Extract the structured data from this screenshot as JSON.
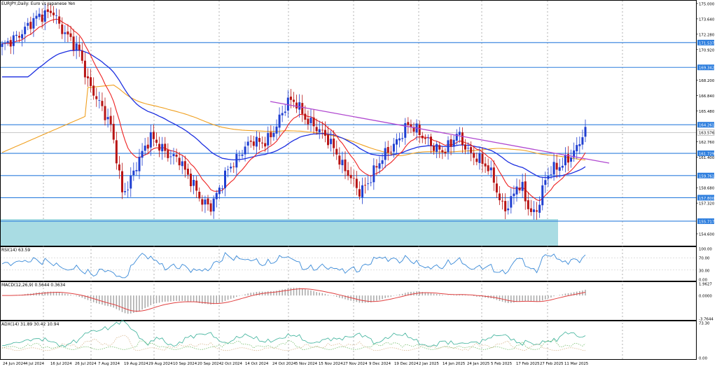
{
  "window": {
    "title": "EURJPY,Daily: Euro vs Japanese Yen"
  },
  "colors": {
    "bull": "#1f3fd1",
    "bear": "#b81414",
    "ma_fast": "#ee2222",
    "ma_mid": "#1c2fe0",
    "ma_slow": "#f0a020",
    "trendline": "#b048d0",
    "hline": "#2f7fde",
    "zone": "#a9dce3",
    "rsi": "#3a8ad8",
    "macd_signal": "#e04040",
    "macd_hist": "#a8a8a8",
    "adx_main": "#38b098",
    "adx_plus": "#7ac070",
    "adx_minus": "#d8b890"
  },
  "price_axis": {
    "ticks": [
      "175.000",
      "173.640",
      "172.280",
      "170.920",
      "169.560",
      "168.200",
      "166.840",
      "165.480",
      "164.120",
      "162.760",
      "161.400",
      "160.040",
      "158.680",
      "157.320",
      "155.960",
      "154.600"
    ]
  },
  "hlines": [
    {
      "label": "171.537",
      "value": 171.537
    },
    {
      "label": "169.342",
      "value": 169.342
    },
    {
      "label": "164.261",
      "value": 164.261
    },
    {
      "label": "163.576",
      "value": 163.576
    },
    {
      "label": "161.729",
      "value": 161.729
    },
    {
      "label": "159.761",
      "value": 159.761
    },
    {
      "label": "157.800",
      "value": 157.8
    },
    {
      "label": "155.717",
      "value": 155.717
    }
  ],
  "date_axis": {
    "labels": [
      "24 Jun 2024",
      "4 Jul 2024",
      "16 Jul 2024",
      "26 Jul 2024",
      "7 Aug 2024",
      "19 Aug 2024",
      "29 Aug 2024",
      "10 Sep 2024",
      "20 Sep 2024",
      "2 Oct 2024",
      "14 Oct 2024",
      "24 Oct 2024",
      "5 Nov 2024",
      "15 Nov 2024",
      "27 Nov 2024",
      "9 Dec 2024",
      "19 Dec 2024",
      "2 Jan 2025",
      "14 Jan 2025",
      "24 Jan 2025",
      "5 Feb 2025",
      "17 Feb 2025",
      "27 Feb 2025",
      "11 Mar 2025"
    ]
  },
  "rsi": {
    "title": "RSI(14) 63.59",
    "ticks": [
      "100.00",
      "70.00",
      "30.00",
      "0.00"
    ]
  },
  "macd": {
    "title": "MACD(12,26,9) 0.5644 0.3634",
    "ticks": [
      "1.9627",
      "0.0000",
      "-3.7644"
    ]
  },
  "adx": {
    "title": "ADX(14) 31.89 30.42 10.94",
    "ticks": [
      "73.30",
      "0.00"
    ]
  }
}
